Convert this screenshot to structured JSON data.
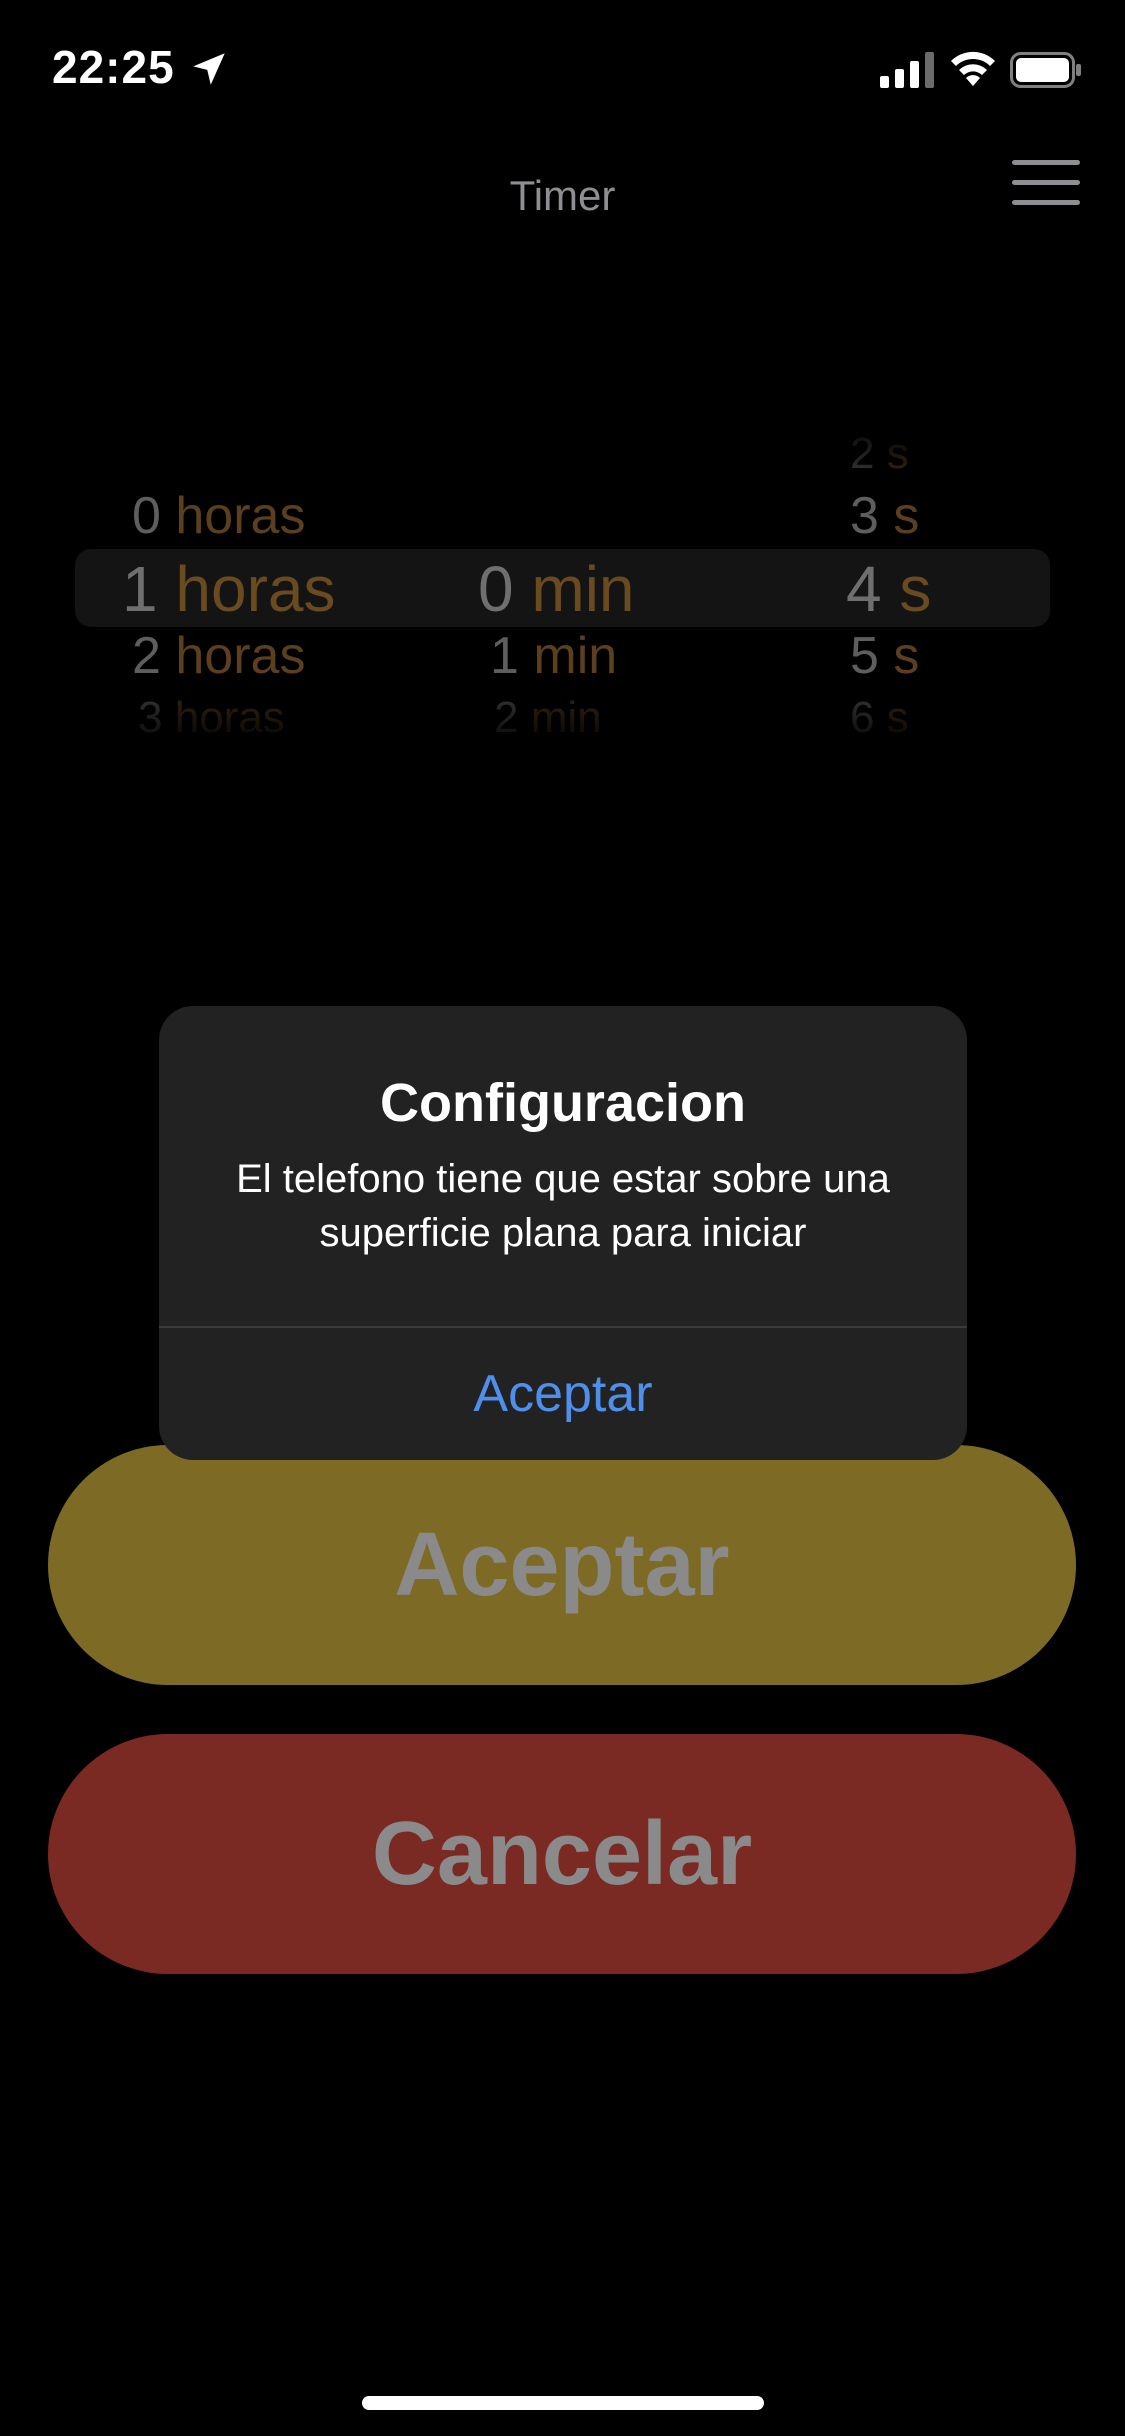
{
  "status_bar": {
    "time": "22:25",
    "icons": [
      "location-arrow-icon",
      "cellular-signal-icon",
      "wifi-icon",
      "battery-icon"
    ]
  },
  "nav": {
    "title": "Timer",
    "menu_icon": "hamburger-menu-icon"
  },
  "picker": {
    "hours": {
      "rows": [
        {
          "value": "0",
          "unit": "horas"
        },
        {
          "value": "1",
          "unit": "horas"
        },
        {
          "value": "2",
          "unit": "horas"
        },
        {
          "value": "3",
          "unit": "horas"
        }
      ],
      "selected": {
        "value": "1",
        "unit": "horas"
      }
    },
    "minutes": {
      "rows": [
        {
          "value": "0",
          "unit": "min"
        },
        {
          "value": "1",
          "unit": "min"
        },
        {
          "value": "2",
          "unit": "min"
        }
      ],
      "selected": {
        "value": "0",
        "unit": "min"
      }
    },
    "seconds": {
      "rows": [
        {
          "value": "2",
          "unit": "s"
        },
        {
          "value": "3",
          "unit": "s"
        },
        {
          "value": "4",
          "unit": "s"
        },
        {
          "value": "5",
          "unit": "s"
        },
        {
          "value": "6",
          "unit": "s"
        }
      ],
      "selected": {
        "value": "4",
        "unit": "s"
      }
    }
  },
  "buttons": {
    "accept_label": "Aceptar",
    "cancel_label": "Cancelar"
  },
  "alert": {
    "title": "Configuracion",
    "message": "El telefono tiene que estar sobre una superficie plana para iniciar",
    "button_label": "Aceptar"
  },
  "colors": {
    "background": "#000000",
    "accept_button": "#7d6b25",
    "cancel_button": "#7a2923",
    "alert_background": "#222222",
    "alert_action": "#4e8fec",
    "picker_unit": "#6a4a1f"
  }
}
